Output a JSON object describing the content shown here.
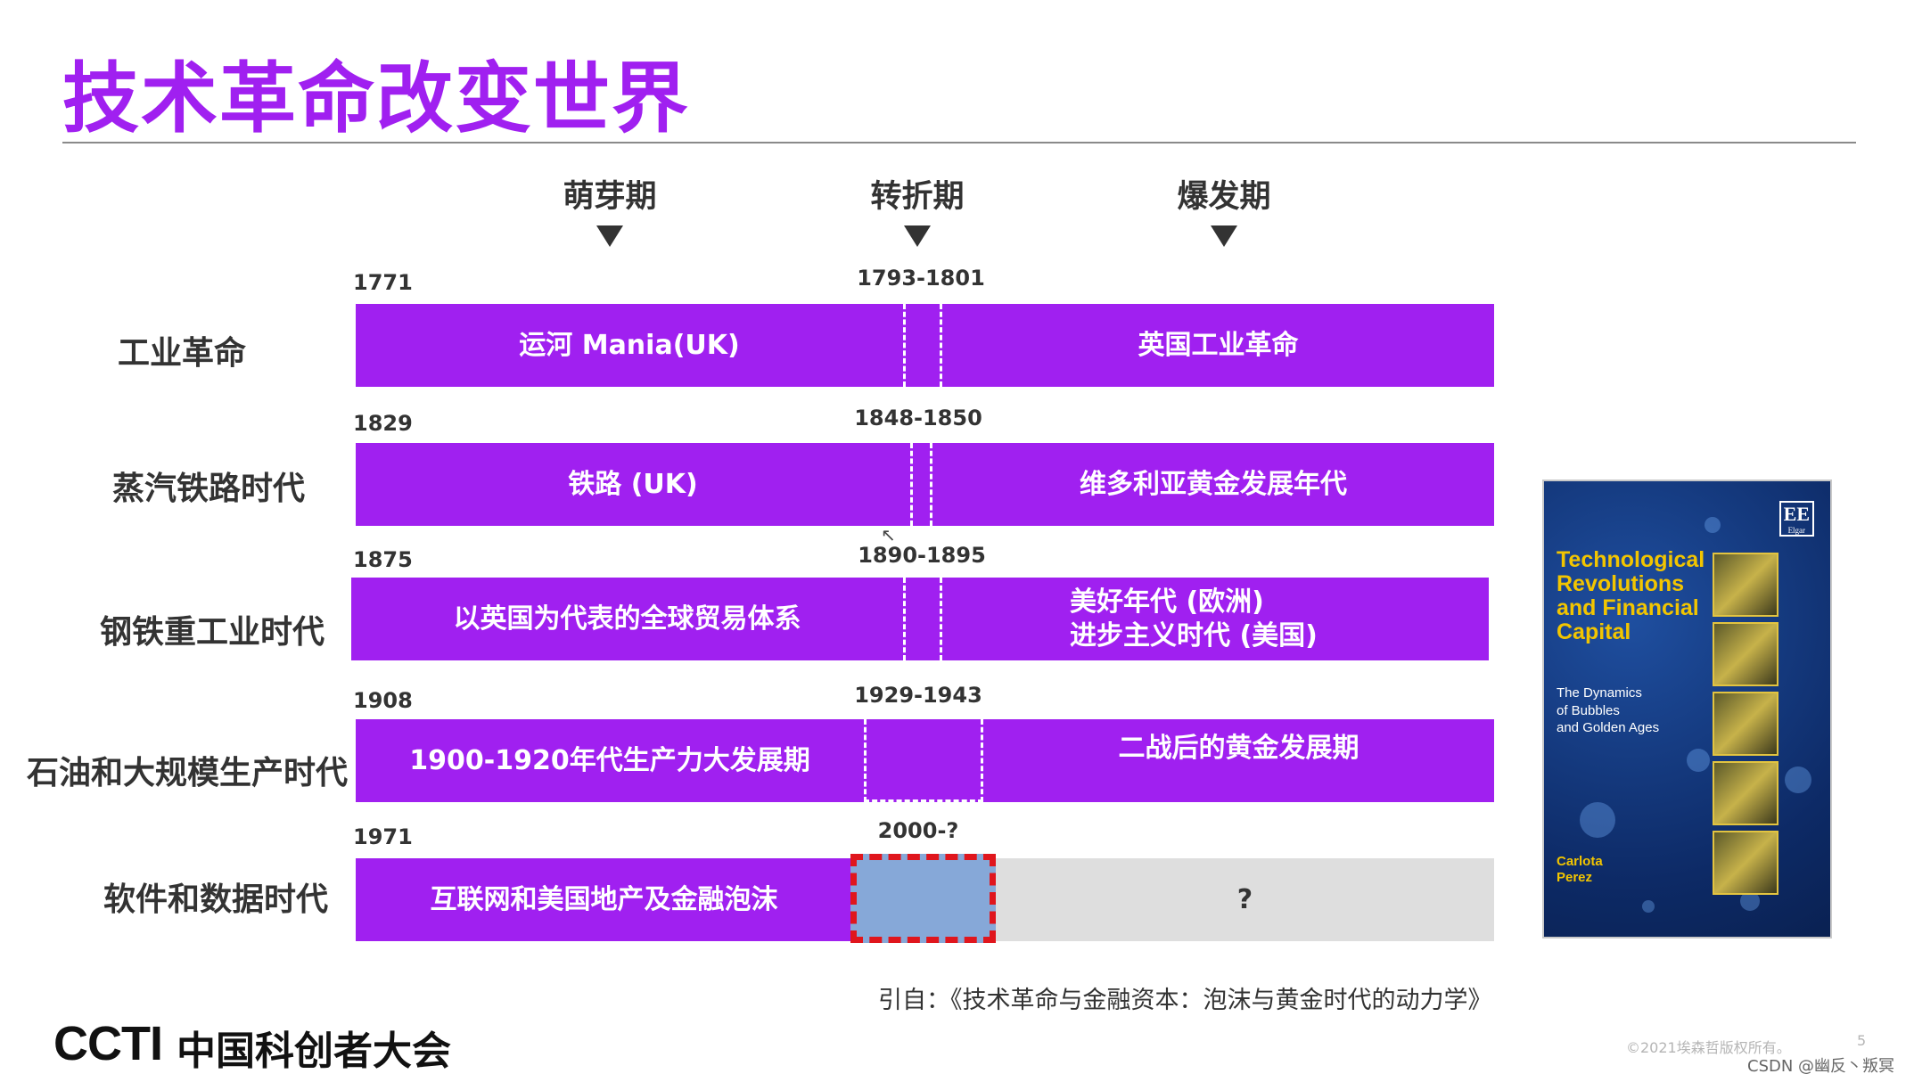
{
  "title": "技术革命改变世界",
  "phases": [
    "萌芽期",
    "转折期",
    "爆发期"
  ],
  "rows": [
    {
      "label": "工业革命",
      "start_year": "1771",
      "turning": "1793-1801",
      "left_bar": "运河 Mania(UK)",
      "right_bar": "英国工业革命"
    },
    {
      "label": "蒸汽铁路时代",
      "start_year": "1829",
      "turning": "1848-1850",
      "left_bar": "铁路 (UK)",
      "right_bar": "维多利亚黄金发展年代"
    },
    {
      "label": "钢铁重工业时代",
      "start_year": "1875",
      "turning": "1890-1895",
      "left_bar": "以英国为代表的全球贸易体系",
      "right_bar_lines": [
        "美好年代 (欧洲)",
        "进步主义时代 (美国)"
      ]
    },
    {
      "label": "石油和大规模生产时代",
      "start_year": "1908",
      "turning": "1929-1943",
      "left_bar": "1900-1920年代生产力大发展期",
      "right_bar": "二战后的黄金发展期"
    },
    {
      "label": "软件和数据时代",
      "start_year": "1971",
      "turning": "2000-?",
      "left_bar": "互联网和美国地产及金融泡沫",
      "right_bar": "?"
    }
  ],
  "citation": "引自：《技术革命与金融资本：泡沫与黄金时代的动力学》",
  "book": {
    "publisher": "EE",
    "publisher_sub": "Elgar",
    "title_lines": [
      "Technological",
      "Revolutions",
      "and Financial",
      "Capital"
    ],
    "subtitle_lines": [
      "The Dynamics",
      "of Bubbles",
      "and Golden Ages"
    ],
    "author_lines": [
      "Carlota",
      "Perez"
    ]
  },
  "footer": {
    "logo": "CCTI",
    "logo_cn": "中国科创者大会",
    "copyright": "©2021埃森哲版权所有。",
    "page": "5",
    "watermark": "CSDN @幽反丶叛冥"
  },
  "colors": {
    "bar": "#a020f0",
    "title": "#a020f0",
    "highlight_fill": "#86a8d8",
    "highlight_border": "#e0161d",
    "unknown_fill": "#dedede"
  }
}
